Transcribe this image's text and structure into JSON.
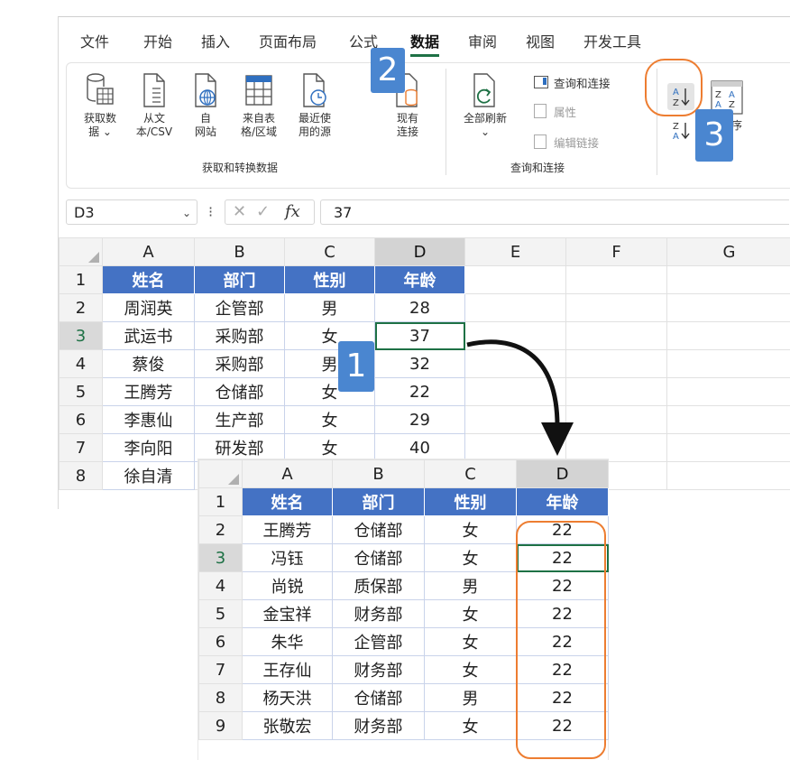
{
  "ribbon_tabs": [
    "文件",
    "开始",
    "插入",
    "页面布局",
    "公式",
    "数据",
    "审阅",
    "视图",
    "开发工具"
  ],
  "active_tab": "数据",
  "ribbon": {
    "get_data": "获取数\n据 ⌄",
    "from_text": "从文\n本/CSV",
    "from_web": "自\n网站",
    "from_table": "来自表\n格/区域",
    "recent_sources": "最近使\n用的源",
    "existing_connections": "现有\n连接",
    "group_get_transform": "获取和转换数据",
    "refresh_all": "全部刷新\n⌄",
    "queries_connections": "查询和连接",
    "properties": "属性",
    "edit_links": "编辑链接",
    "group_queries": "查询和连接",
    "sort_partial": "序"
  },
  "formula_bar": {
    "name_box": "D3",
    "name_chevron": "⌄",
    "dots": "⁝",
    "cancel": "✕",
    "enter": "✓",
    "fx": "fx",
    "value": "37"
  },
  "columns": [
    "A",
    "B",
    "C",
    "D",
    "E",
    "F",
    "G"
  ],
  "inset_columns": [
    "A",
    "B",
    "C",
    "D"
  ],
  "table_headers": [
    "姓名",
    "部门",
    "性别",
    "年龄"
  ],
  "main_rows": [
    {
      "n": "2",
      "cells": [
        "周润英",
        "企管部",
        "男",
        "28"
      ]
    },
    {
      "n": "3",
      "cells": [
        "武运书",
        "采购部",
        "女",
        "37"
      ]
    },
    {
      "n": "4",
      "cells": [
        "蔡俊",
        "采购部",
        "男",
        "32"
      ]
    },
    {
      "n": "5",
      "cells": [
        "王腾芳",
        "仓储部",
        "女",
        "22"
      ]
    },
    {
      "n": "6",
      "cells": [
        "李惠仙",
        "生产部",
        "女",
        "29"
      ]
    },
    {
      "n": "7",
      "cells": [
        "李向阳",
        "研发部",
        "女",
        "40"
      ]
    },
    {
      "n": "8",
      "cells": [
        "徐自清",
        "",
        "",
        ""
      ]
    }
  ],
  "sorted_rows": [
    {
      "n": "2",
      "cells": [
        "王腾芳",
        "仓储部",
        "女",
        "22"
      ]
    },
    {
      "n": "3",
      "cells": [
        "冯钰",
        "仓储部",
        "女",
        "22"
      ]
    },
    {
      "n": "4",
      "cells": [
        "尚锐",
        "质保部",
        "男",
        "22"
      ]
    },
    {
      "n": "5",
      "cells": [
        "金宝祥",
        "财务部",
        "女",
        "22"
      ]
    },
    {
      "n": "6",
      "cells": [
        "朱华",
        "企管部",
        "女",
        "22"
      ]
    },
    {
      "n": "7",
      "cells": [
        "王存仙",
        "财务部",
        "女",
        "22"
      ]
    },
    {
      "n": "8",
      "cells": [
        "杨天洪",
        "仓储部",
        "男",
        "22"
      ]
    },
    {
      "n": "9",
      "cells": [
        "张敬宏",
        "财务部",
        "女",
        "22"
      ]
    }
  ],
  "row1": "1",
  "steps": {
    "step1": "1",
    "step2": "2",
    "step3": "3"
  },
  "colors": {
    "accent": "#1e7145",
    "header_fill": "#4472c4",
    "badge": "#4a86d0",
    "highlight": "#ed7d31"
  }
}
